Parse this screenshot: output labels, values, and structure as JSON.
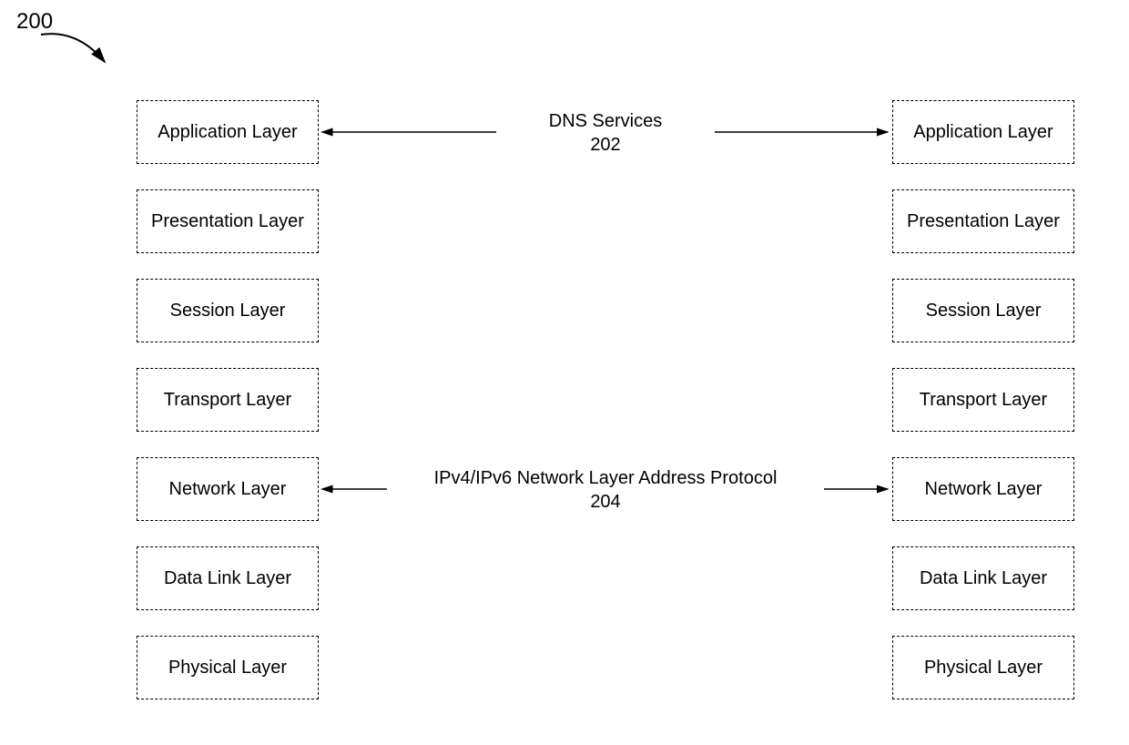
{
  "figure": {
    "number": "200"
  },
  "left": {
    "application": "Application Layer",
    "presentation": "Presentation Layer",
    "session": "Session Layer",
    "transport": "Transport Layer",
    "network": "Network Layer",
    "datalink": "Data Link Layer",
    "physical": "Physical Layer"
  },
  "right": {
    "application": "Application Layer",
    "presentation": "Presentation Layer",
    "session": "Session Layer",
    "transport": "Transport Layer",
    "network": "Network Layer",
    "datalink": "Data Link Layer",
    "physical": "Physical Layer"
  },
  "connections": {
    "dns": {
      "title": "DNS Services",
      "ref": "202"
    },
    "ip": {
      "title": "IPv4/IPv6 Network Layer Address Protocol",
      "ref": "204"
    }
  }
}
